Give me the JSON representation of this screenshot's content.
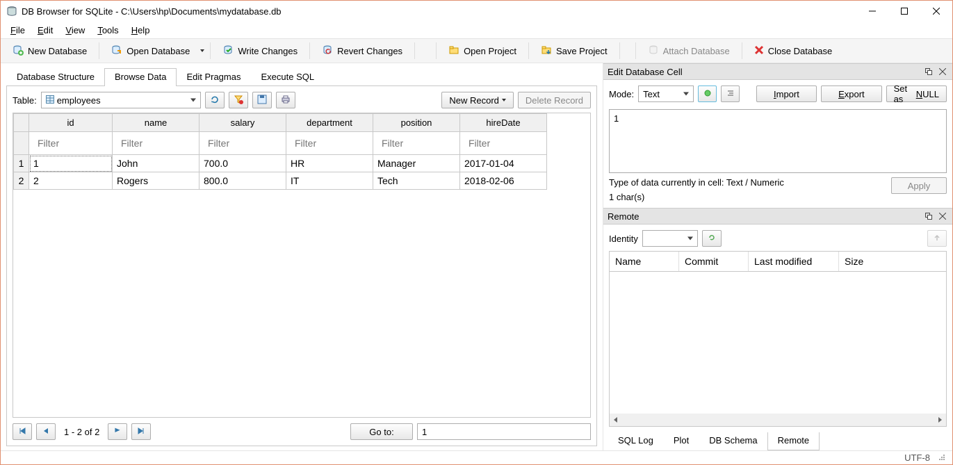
{
  "window": {
    "title": "DB Browser for SQLite - C:\\Users\\hp\\Documents\\mydatabase.db"
  },
  "menu": {
    "file": "File",
    "edit": "Edit",
    "view": "View",
    "tools": "Tools",
    "help": "Help"
  },
  "toolbar": {
    "new_db": "New Database",
    "open_db": "Open Database",
    "write_changes": "Write Changes",
    "revert_changes": "Revert Changes",
    "open_project": "Open Project",
    "save_project": "Save Project",
    "attach_db": "Attach Database",
    "close_db": "Close Database"
  },
  "main_tabs": {
    "structure": "Database Structure",
    "browse": "Browse Data",
    "pragmas": "Edit Pragmas",
    "sql": "Execute SQL"
  },
  "browse": {
    "table_label": "Table:",
    "table_selected": "employees",
    "new_record": "New Record",
    "delete_record": "Delete Record",
    "columns": [
      "id",
      "name",
      "salary",
      "department",
      "position",
      "hireDate"
    ],
    "filter_placeholder": "Filter",
    "rows": [
      {
        "num": "1",
        "cells": [
          "1",
          "John",
          "700.0",
          "HR",
          "Manager",
          "2017-01-04"
        ]
      },
      {
        "num": "2",
        "cells": [
          "2",
          "Rogers",
          "800.0",
          "IT",
          "Tech",
          "2018-02-06"
        ]
      }
    ],
    "pager_text": "1 - 2 of 2",
    "goto_label": "Go to:",
    "goto_value": "1"
  },
  "edit_cell": {
    "title": "Edit Database Cell",
    "mode_label": "Mode:",
    "mode_value": "Text",
    "import": "Import",
    "export": "Export",
    "set_null": "Set as NULL",
    "value": "1",
    "type_text": "Type of data currently in cell: Text / Numeric",
    "chars": "1 char(s)",
    "apply": "Apply"
  },
  "remote": {
    "title": "Remote",
    "identity_label": "Identity",
    "columns": {
      "name": "Name",
      "commit": "Commit",
      "last_modified": "Last modified",
      "size": "Size"
    }
  },
  "bottom_tabs": {
    "sql_log": "SQL Log",
    "plot": "Plot",
    "db_schema": "DB Schema",
    "remote": "Remote"
  },
  "status": {
    "encoding": "UTF-8"
  }
}
